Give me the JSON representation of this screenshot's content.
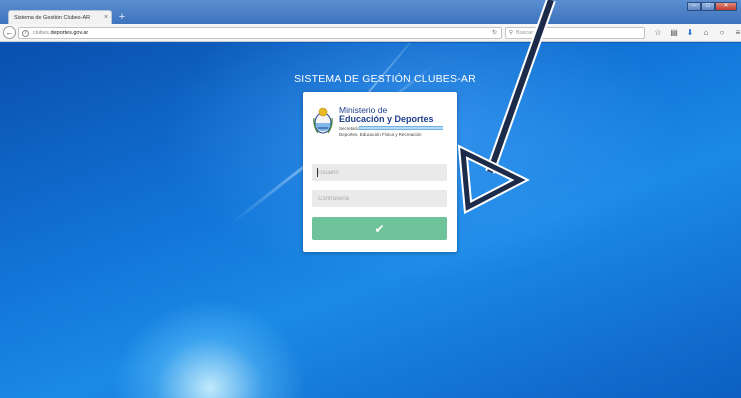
{
  "browser": {
    "tab_title": "Sistema de Gestión Clubes-AR",
    "tab_close": "×",
    "new_tab": "+",
    "url_subdomain": "clubes.",
    "url_domain": "deportes.gov.ar",
    "search_placeholder": "Buscar",
    "toolbar_icons": [
      "star-icon",
      "reading-list-icon",
      "download-icon",
      "home-icon",
      "chat-icon",
      "menu-icon"
    ]
  },
  "page": {
    "system_title": "SISTEMA DE GESTIÓN CLUBES-AR",
    "logo": {
      "line1": "Ministerio de",
      "line2": "Educación y Deportes",
      "line3": "Secretaría de",
      "line4": "Deportes, Educación Física y Recreación"
    },
    "form": {
      "username_placeholder": "Usuario",
      "password_placeholder": "Contraseña",
      "submit_icon": "✔"
    }
  },
  "colors": {
    "submit_button": "#6ec39a",
    "annotation_arrow": "#1c2b4a",
    "logo_text": "#1f3f8c"
  }
}
